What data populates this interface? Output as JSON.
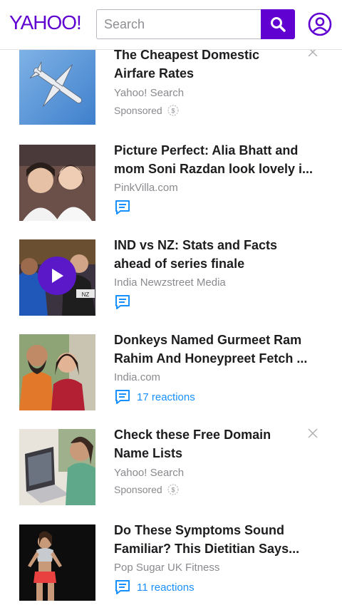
{
  "header": {
    "logo_text": "YAHOO!",
    "search_placeholder": "Search"
  },
  "colors": {
    "brand": "#6001d2",
    "link": "#188fff"
  },
  "feed": [
    {
      "title_line1": "The Cheapest Domestic",
      "title_line2": "Airfare Rates",
      "source": "Yahoo! Search",
      "sponsored": "Sponsored",
      "thumb": "airplane-sky"
    },
    {
      "title_line1": "Picture Perfect: Alia Bhatt and",
      "title_line2": "mom Soni Razdan look lovely i...",
      "source": "PinkVilla.com",
      "thumb": "two-women-selfie"
    },
    {
      "title_line1": "IND vs NZ: Stats and Facts",
      "title_line2": "ahead of series finale",
      "source": "India Newzstreet Media",
      "thumb": "cricket-players-video"
    },
    {
      "title_line1": "Donkeys Named Gurmeet Ram",
      "title_line2": "Rahim And Honeypreet Fetch ...",
      "source": "India.com",
      "reactions": "17 reactions",
      "thumb": "man-and-woman"
    },
    {
      "title_line1": "Check these Free Domain",
      "title_line2": "Name Lists",
      "source": "Yahoo! Search",
      "sponsored": "Sponsored",
      "thumb": "laptop-user"
    },
    {
      "title_line1": "Do These Symptoms Sound",
      "title_line2": "Familiar? This Dietitian Says...",
      "source": "Pop Sugar UK Fitness",
      "reactions": "11 reactions",
      "thumb": "fitness-woman"
    }
  ]
}
